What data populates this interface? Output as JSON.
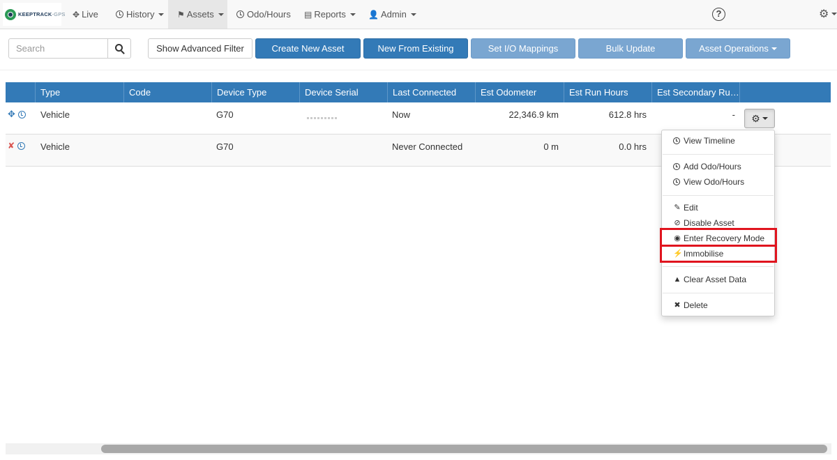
{
  "navbar": {
    "logo_brand": "KEEPTRACK",
    "logo_suffix": "-GPS",
    "items": [
      {
        "label": "Live",
        "icon": "move-icon"
      },
      {
        "label": "History",
        "icon": "clock-icon"
      },
      {
        "label": "Assets",
        "icon": "flag-icon"
      },
      {
        "label": "Odo/Hours",
        "icon": "dashboard-icon"
      },
      {
        "label": "Reports",
        "icon": "list-icon"
      },
      {
        "label": "Admin",
        "icon": "user-icon"
      }
    ],
    "active_item": "Assets",
    "help_symbol": "?",
    "settings_icon": "gear-icon"
  },
  "toolbar": {
    "search_placeholder": "Search",
    "show_filter": "Show Advanced Filter",
    "create": "Create New Asset",
    "new_from_existing": "New From Existing",
    "io_mappings": "Set I/O Mappings",
    "bulk_update": "Bulk Update",
    "asset_ops": "Asset Operations"
  },
  "table": {
    "columns": [
      "",
      "Type",
      "Code",
      "Device Type",
      "Device Serial",
      "Last Connected",
      "Est Odometer",
      "Est Run Hours",
      "Est Secondary Ru…",
      ""
    ],
    "rows": [
      {
        "status_icon": "move-icon",
        "type": "Vehicle",
        "code": "",
        "device_type": "G70",
        "device_serial": "",
        "last_connected": "Now",
        "odometer": "22,346.9 km",
        "run_hours": "612.8 hrs",
        "secondary": "-"
      },
      {
        "status_icon": "no-move-icon",
        "type": "Vehicle",
        "code": "",
        "device_type": "G70",
        "device_serial": "",
        "last_connected": "Never Connected",
        "odometer": "0 m",
        "run_hours": "0.0 hrs",
        "secondary": ""
      }
    ]
  },
  "dropdown": {
    "items": [
      {
        "label": "View Timeline",
        "icon": "clock-icon"
      },
      {
        "label": "Add Odo/Hours",
        "icon": "dashboard-icon"
      },
      {
        "label": "View Odo/Hours",
        "icon": "dashboard-icon"
      },
      {
        "label": "Edit",
        "icon": "edit-icon"
      },
      {
        "label": "Disable Asset",
        "icon": "ban-icon"
      },
      {
        "label": "Enter Recovery Mode",
        "icon": "eye-icon"
      },
      {
        "label": "Immobilise",
        "icon": "bolt-icon"
      },
      {
        "label": "Clear Asset Data",
        "icon": "warning-icon"
      },
      {
        "label": "Delete",
        "icon": "close-icon"
      }
    ],
    "highlighted": [
      "Enter Recovery Mode",
      "Immobilise"
    ],
    "highlight_color": "#e0141e"
  },
  "colors": {
    "primary": "#337ab7",
    "disabled": "#7aa6d1",
    "danger": "#d9534f"
  }
}
